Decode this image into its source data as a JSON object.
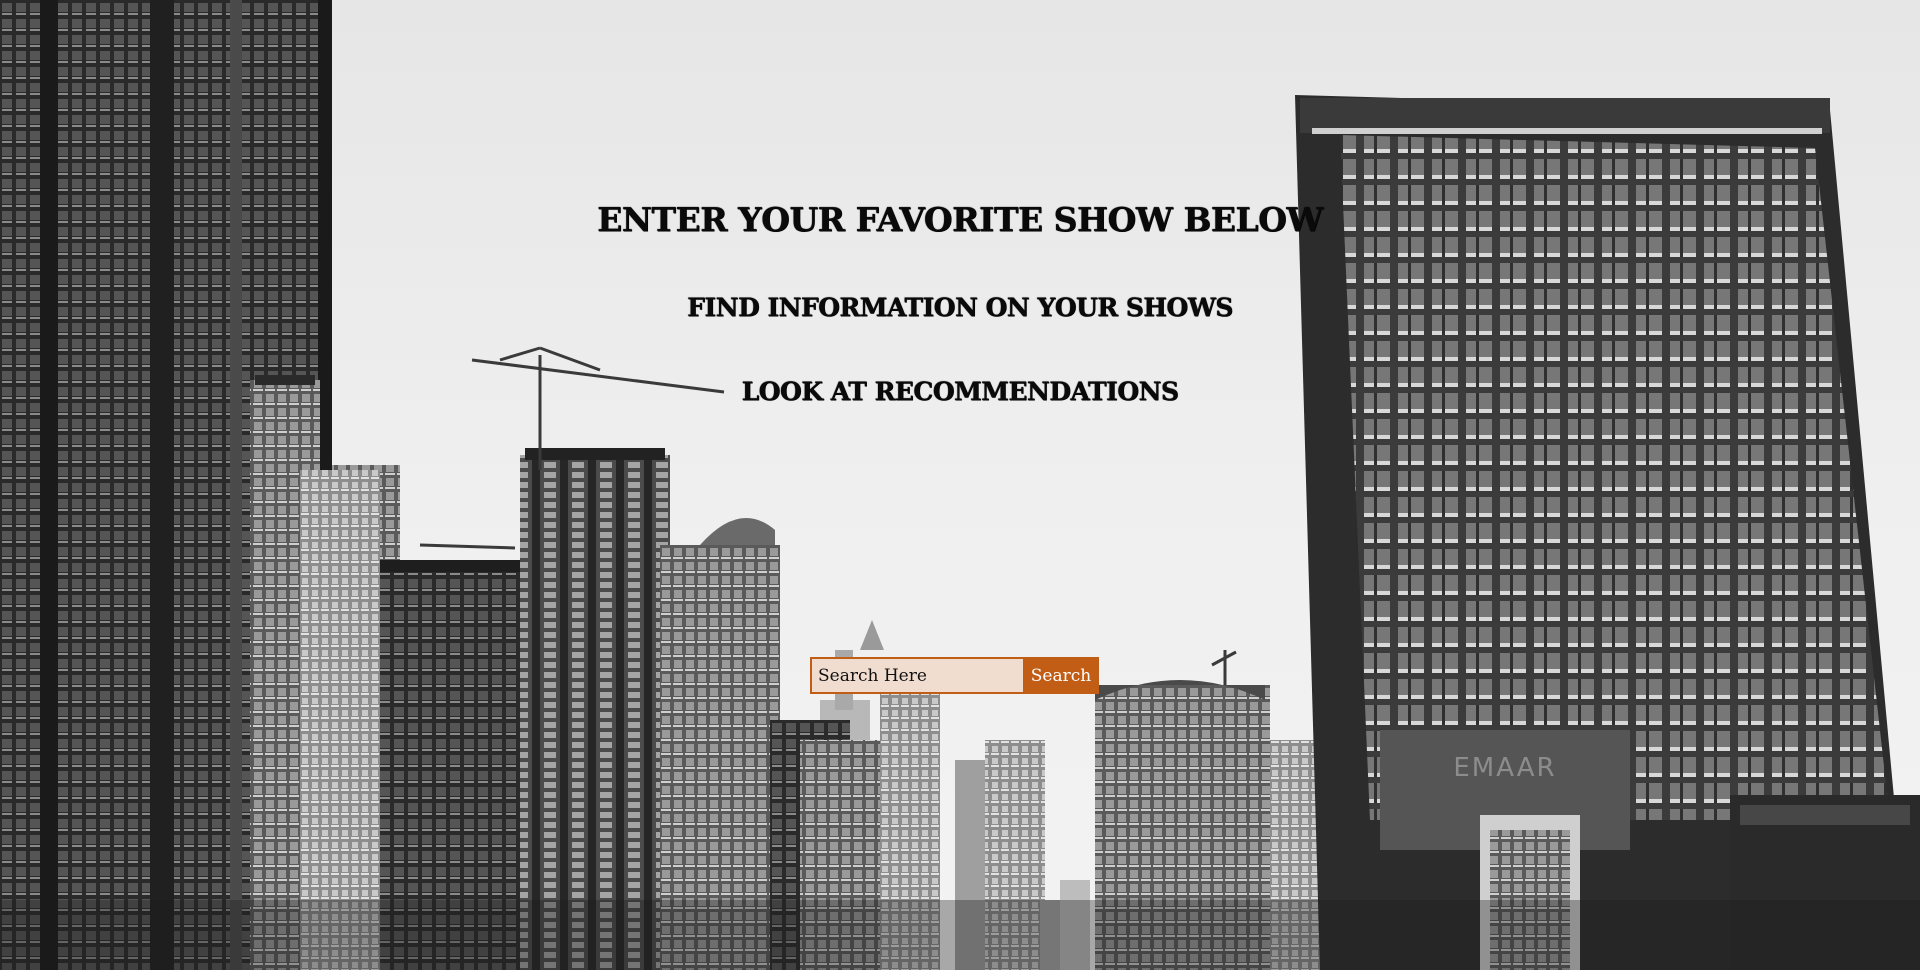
{
  "hero": {
    "headline": "ENTER YOUR FAVORITE SHOW BELOW",
    "subline_1": "FIND INFORMATION ON YOUR SHOWS",
    "subline_2": "LOOK AT RECOMMENDATIONS"
  },
  "search": {
    "placeholder": "Search Here",
    "button_label": "Search"
  },
  "background": {
    "building_sign": "EMAAR"
  },
  "colors": {
    "accent": "#c25d16",
    "input_background": "#f1ddd0",
    "sky": "#ececec"
  }
}
